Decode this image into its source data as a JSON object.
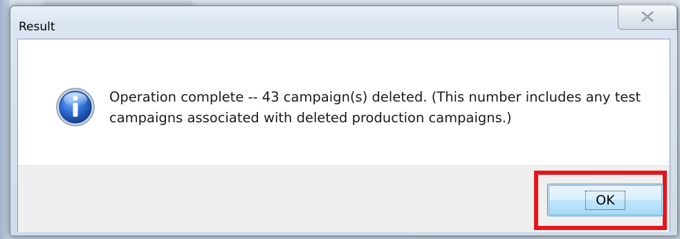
{
  "dialog": {
    "title": "Result",
    "message": "Operation complete -- 43 campaign(s) deleted.  (This number includes any test campaigns associated with deleted production campaigns.)",
    "ok_label": "OK",
    "icon": "info-icon",
    "close_icon": "close-icon"
  },
  "colors": {
    "highlight": "#e8141b",
    "ok_button_border": "#3c7fb1",
    "info_icon_blue": "#1f5fbf"
  }
}
